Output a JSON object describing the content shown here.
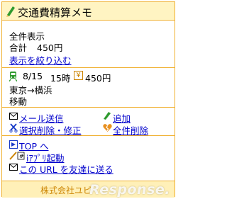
{
  "header": {
    "title": "交通費精算メモ"
  },
  "summary": {
    "label": "全件表示",
    "total_label": "合計",
    "total_value": "450円",
    "filter_link": "表示を絞り込む"
  },
  "entry": {
    "date": "8/15",
    "time": "15時",
    "amount": "450円",
    "route": "東京→横浜",
    "category": "移動"
  },
  "actions": {
    "send_mail": "メール送信",
    "add": "追加",
    "select_delete_edit": "選択削除・修正",
    "delete_all": "全件削除"
  },
  "nav": {
    "top": "TOP へ",
    "iappli": "iｱﾌﾟﾘ起動",
    "share": "この URL を友達に送る"
  },
  "footer": {
    "company": "株式会社ユビ",
    "watermark": "Response."
  },
  "colors": {
    "border": "#f0b030",
    "header_bg": "#fff4c2",
    "link": "#0000cc",
    "accent": "#cc8400"
  }
}
